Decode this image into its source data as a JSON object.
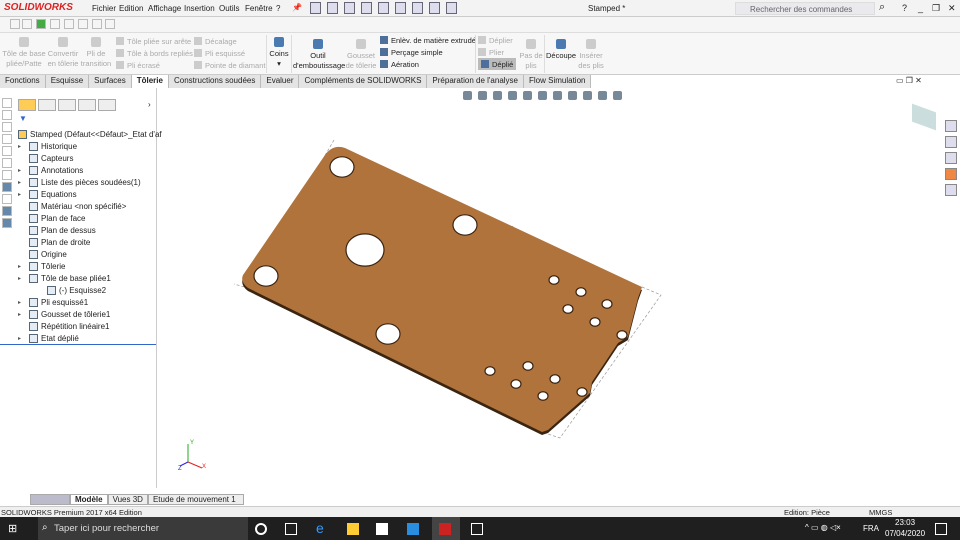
{
  "app": {
    "logo": "SOLIDWORKS",
    "document": "Stamped *"
  },
  "menu": [
    "Fichier",
    "Edition",
    "Affichage",
    "Insertion",
    "Outils",
    "Fenêtre",
    "?"
  ],
  "search": {
    "placeholder": "Rechercher des commandes"
  },
  "window_controls": [
    "?",
    "_",
    "❐",
    "✕"
  ],
  "ribbon": {
    "big_left": [
      "Tôle de base pliée/Patte",
      "Convertir en tôlerie",
      "Pli de transition"
    ],
    "col1": [
      "Tôle pliée sur arête",
      "Tôle à bords repliés",
      "Pli écrasé"
    ],
    "col2": [
      "Décalage",
      "Pli esquissé",
      "Pointe de diamant"
    ],
    "coins": "Coins",
    "outil": "Outil d'emboutissage",
    "gousset": "Gousset de tôlerie",
    "col3": [
      "Enlèv. de matière extrudé",
      "Perçage simple",
      "Aération"
    ],
    "col4": [
      "Déplier",
      "Plier",
      "Déplié"
    ],
    "pas": "Pas de plis",
    "decoupe": "Découpe",
    "inserer": "Insérer des plis"
  },
  "tabs": [
    "Fonctions",
    "Esquisse",
    "Surfaces",
    "Tôlerie",
    "Constructions soudées",
    "Evaluer",
    "Compléments de SOLIDWORKS",
    "Préparation de l'analyse",
    "Flow Simulation"
  ],
  "active_tab": "Tôlerie",
  "tree": {
    "root": "Stamped  (Défaut<<Défaut>_Etat d'af",
    "items": [
      {
        "label": "Historique",
        "expand": true,
        "indent": 0
      },
      {
        "label": "Capteurs",
        "expand": false,
        "indent": 0
      },
      {
        "label": "Annotations",
        "expand": true,
        "indent": 0
      },
      {
        "label": "Liste des pièces soudées(1)",
        "expand": true,
        "indent": 0
      },
      {
        "label": "Equations",
        "expand": true,
        "indent": 0
      },
      {
        "label": "Matériau <non spécifié>",
        "expand": false,
        "indent": 0
      },
      {
        "label": "Plan de face",
        "expand": false,
        "indent": 0
      },
      {
        "label": "Plan de dessus",
        "expand": false,
        "indent": 0
      },
      {
        "label": "Plan de droite",
        "expand": false,
        "indent": 0
      },
      {
        "label": "Origine",
        "expand": false,
        "indent": 0
      },
      {
        "label": "Tôlerie",
        "expand": true,
        "indent": 0
      },
      {
        "label": "Tôle de base pliée1",
        "expand": true,
        "indent": 0
      },
      {
        "label": "(-) Esquisse2",
        "expand": false,
        "indent": 1
      },
      {
        "label": "Pli esquissé1",
        "expand": true,
        "indent": 0
      },
      {
        "label": "Gousset de tôlerie1",
        "expand": true,
        "indent": 0
      },
      {
        "label": "Répétition linéaire1",
        "expand": false,
        "indent": 0
      },
      {
        "label": "Etat déplié",
        "expand": true,
        "indent": 0
      }
    ]
  },
  "bottom_tabs": [
    "Modèle",
    "Vues 3D",
    "Etude de mouvement 1"
  ],
  "status": {
    "left": "SOLIDWORKS Premium 2017 x64 Edition",
    "edition": "Edition: Pièce",
    "units": "MMGS"
  },
  "taskbar": {
    "search": "Taper ici pour rechercher",
    "lang": "FRA",
    "time": "23:03",
    "date": "07/04/2020"
  },
  "triad": {
    "x": "X",
    "y": "Y",
    "z": "Z"
  },
  "colors": {
    "part": "#b0733c",
    "accent": "#d22"
  }
}
